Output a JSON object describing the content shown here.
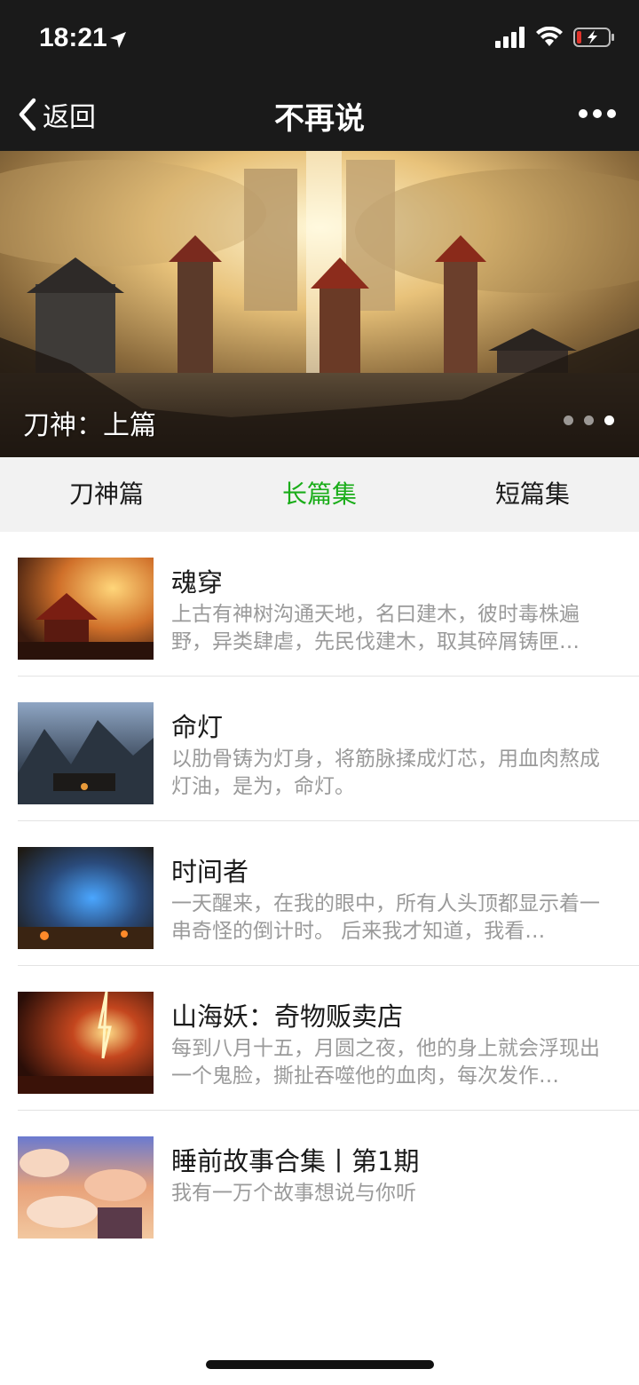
{
  "status_bar": {
    "time": "18:21"
  },
  "nav": {
    "back_label": "返回",
    "title": "不再说"
  },
  "banner": {
    "caption": "刀神：上篇",
    "slide_count": 3,
    "active_index": 2
  },
  "tabs": [
    {
      "label": "刀神篇",
      "active": false
    },
    {
      "label": "长篇集",
      "active": true
    },
    {
      "label": "短篇集",
      "active": false
    }
  ],
  "accent_color": "#1aad19",
  "items": [
    {
      "title": "魂穿",
      "desc": "上古有神树沟通天地，名曰建木，彼时毒株遍野，异类肆虐，先民伐建木，取其碎屑铸匣…"
    },
    {
      "title": "命灯",
      "desc": "以肋骨铸为灯身，将筋脉揉成灯芯，用血肉熬成灯油，是为，命灯。"
    },
    {
      "title": "时间者",
      "desc": "一天醒来，在我的眼中，所有人头顶都显示着一串奇怪的倒计时。 后来我才知道，我看…"
    },
    {
      "title": "山海妖：奇物贩卖店",
      "desc": "每到八月十五，月圆之夜，他的身上就会浮现出一个鬼脸，撕扯吞噬他的血肉，每次发作…"
    },
    {
      "title": "睡前故事合集丨第1期",
      "desc": "我有一万个故事想说与你听"
    }
  ]
}
